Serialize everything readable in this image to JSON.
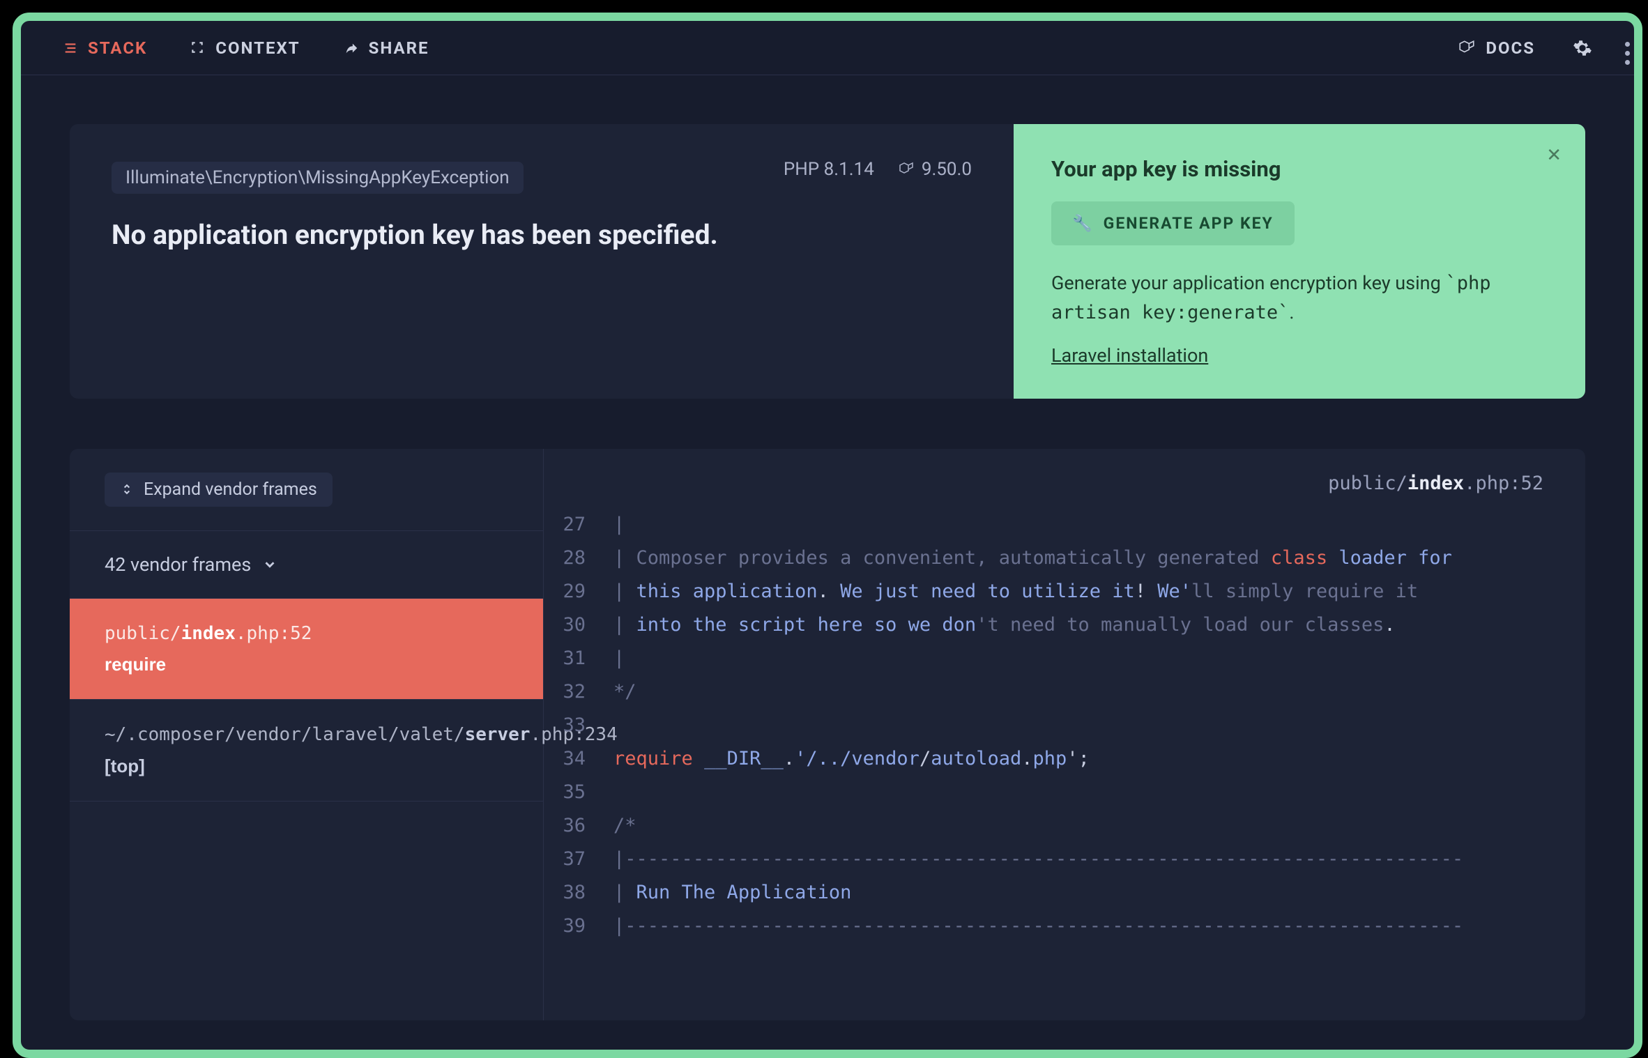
{
  "nav": {
    "stack": "STACK",
    "context": "CONTEXT",
    "share": "SHARE",
    "docs": "DOCS"
  },
  "exception": {
    "class": "Illuminate\\Encryption\\MissingAppKeyException",
    "message": "No application encryption key has been specified.",
    "php_label": "PHP 8.1.14",
    "laravel_version": "9.50.0"
  },
  "solution": {
    "title": "Your app key is missing",
    "button": "GENERATE APP KEY",
    "desc_a": "Generate your application encryption key using ",
    "desc_code": "`php artisan key:generate`",
    "desc_b": ".",
    "link": "Laravel installation"
  },
  "frames": {
    "expand": "Expand vendor frames",
    "vendor_toggle": "42 vendor frames",
    "active": {
      "prefix": "public/",
      "file": "index",
      "suffix": ".php",
      "line": ":52",
      "fn": "require"
    },
    "next": {
      "prefix": "~/.composer/vendor/laravel/valet/",
      "file": "server",
      "suffix": ".php",
      "line": ":234",
      "fn": "[top]"
    }
  },
  "filepath": {
    "prefix": "public/",
    "file": "index",
    "suffix": ".php",
    "line": ":52"
  },
  "code": [
    {
      "n": 27,
      "segs": [
        {
          "t": "| ",
          "c": "bar"
        }
      ]
    },
    {
      "n": 28,
      "segs": [
        {
          "t": "| ",
          "c": "bar"
        },
        {
          "t": "Composer provides a convenient, automatically generated ",
          "c": "comment"
        },
        {
          "t": "class",
          "c": "kw"
        },
        {
          "t": " ",
          "c": "comment"
        },
        {
          "t": "loader for",
          "c": "str"
        }
      ]
    },
    {
      "n": 29,
      "segs": [
        {
          "t": "| ",
          "c": "bar"
        },
        {
          "t": "this application",
          "c": "str"
        },
        {
          "t": ". ",
          "c": "punct"
        },
        {
          "t": "We just need to utilize it",
          "c": "str"
        },
        {
          "t": "! ",
          "c": "punct"
        },
        {
          "t": "We'",
          "c": "str"
        },
        {
          "t": "ll simply require it",
          "c": "comment"
        }
      ]
    },
    {
      "n": 30,
      "segs": [
        {
          "t": "| ",
          "c": "bar"
        },
        {
          "t": "into the script here so we don",
          "c": "str"
        },
        {
          "t": "'t need to manually load our classes",
          "c": "comment"
        },
        {
          "t": ".",
          "c": "punct"
        }
      ]
    },
    {
      "n": 31,
      "segs": [
        {
          "t": "| ",
          "c": "bar"
        }
      ]
    },
    {
      "n": 32,
      "segs": [
        {
          "t": "*/",
          "c": "comment"
        }
      ]
    },
    {
      "n": 33,
      "segs": [
        {
          "t": "",
          "c": "comment"
        }
      ]
    },
    {
      "n": 34,
      "segs": [
        {
          "t": "require",
          "c": "kw"
        },
        {
          "t": " ",
          "c": "punct"
        },
        {
          "t": "__DIR__",
          "c": "str"
        },
        {
          "t": ".",
          "c": "punct"
        },
        {
          "t": "'/../",
          "c": "str"
        },
        {
          "t": "vendor",
          "c": "str"
        },
        {
          "t": "/",
          "c": "punct"
        },
        {
          "t": "autoload",
          "c": "str"
        },
        {
          "t": ".",
          "c": "punct"
        },
        {
          "t": "php",
          "c": "str"
        },
        {
          "t": "';",
          "c": "punct"
        }
      ]
    },
    {
      "n": 35,
      "segs": [
        {
          "t": "",
          "c": "comment"
        }
      ]
    },
    {
      "n": 36,
      "segs": [
        {
          "t": "/*",
          "c": "comment"
        }
      ]
    },
    {
      "n": 37,
      "segs": [
        {
          "t": "|--------------------------------------------------------------------------",
          "c": "comment"
        }
      ]
    },
    {
      "n": 38,
      "segs": [
        {
          "t": "| ",
          "c": "bar"
        },
        {
          "t": "Run The Application",
          "c": "str"
        }
      ]
    },
    {
      "n": 39,
      "segs": [
        {
          "t": "|--------------------------------------------------------------------------",
          "c": "comment"
        }
      ]
    }
  ]
}
